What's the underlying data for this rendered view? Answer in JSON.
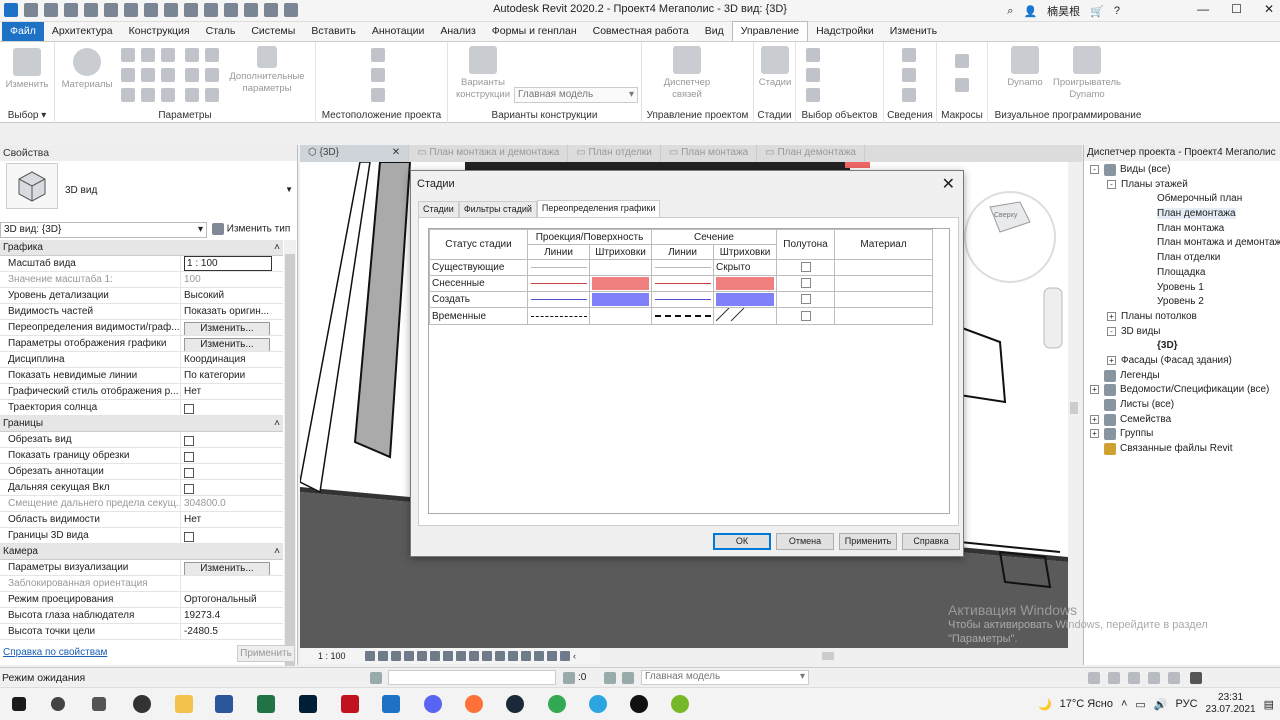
{
  "app": {
    "title": "Autodesk Revit 2020.2 - Проект4 Мегаполис - 3D вид: {3D}",
    "user": "楠昊根"
  },
  "menu": {
    "tabs": [
      "Файл",
      "Архитектура",
      "Конструкция",
      "Сталь",
      "Системы",
      "Вставить",
      "Аннотации",
      "Анализ",
      "Формы и генплан",
      "Совместная работа",
      "Вид",
      "Управление",
      "Надстройки",
      "Изменить"
    ],
    "active": "Управление"
  },
  "ribbon": {
    "modify": "Изменить",
    "materials": "Материалы",
    "additional_params": "Дополнительные параметры",
    "design_options": "Варианты конструкции",
    "main_model": "Главная модель",
    "links_manager": "Диспетчер связей",
    "phases": "Стадии",
    "dynamo": "Dynamo",
    "dynamo_player": "Проигрыватель Dynamo",
    "groups": {
      "select": "Выбор",
      "params": "Параметры",
      "location": "Местоположение проекта",
      "design_options": "Варианты конструкции",
      "project_manage": "Управление проектом",
      "phases": "Стадии",
      "select_objects": "Выбор объектов",
      "info": "Сведения",
      "macros": "Макросы",
      "visual_prog": "Визуальное программирование"
    }
  },
  "properties": {
    "header": "Свойства",
    "type_name": "3D вид",
    "instance": "3D вид: {3D}",
    "edit_type": "Изменить тип",
    "sections": [
      {
        "title": "Графика",
        "rows": [
          {
            "k": "Масштаб вида",
            "v": "1 : 100",
            "kind": "input"
          },
          {
            "k": "Значение масштаба    1:",
            "v": "100",
            "kind": "dis"
          },
          {
            "k": "Уровень детализации",
            "v": "Высокий"
          },
          {
            "k": "Видимость частей",
            "v": "Показать оригин..."
          },
          {
            "k": "Переопределения видимости/граф...",
            "v": "Изменить...",
            "kind": "btn"
          },
          {
            "k": "Параметры отображения графики",
            "v": "Изменить...",
            "kind": "btn"
          },
          {
            "k": "Дисциплина",
            "v": "Координация"
          },
          {
            "k": "Показать невидимые линии",
            "v": "По категории"
          },
          {
            "k": "Графический стиль отображения р...",
            "v": "Нет"
          },
          {
            "k": "Траектория солнца",
            "v": "",
            "kind": "cb"
          }
        ]
      },
      {
        "title": "Границы",
        "rows": [
          {
            "k": "Обрезать вид",
            "v": "",
            "kind": "cb"
          },
          {
            "k": "Показать границу обрезки",
            "v": "",
            "kind": "cb"
          },
          {
            "k": "Обрезать аннотации",
            "v": "",
            "kind": "cb"
          },
          {
            "k": "Дальняя секущая Вкл",
            "v": "",
            "kind": "cb"
          },
          {
            "k": "Смещение дальнего предела секущ...",
            "v": "304800.0",
            "kind": "dis"
          },
          {
            "k": "Область видимости",
            "v": "Нет"
          },
          {
            "k": "Границы 3D вида",
            "v": "",
            "kind": "cb"
          }
        ]
      },
      {
        "title": "Камера",
        "rows": [
          {
            "k": "Параметры визуализации",
            "v": "Изменить...",
            "kind": "btn"
          },
          {
            "k": "Заблокированная ориентация",
            "v": "",
            "kind": "dis"
          },
          {
            "k": "Режим проецирования",
            "v": "Ортогональный"
          },
          {
            "k": "Высота глаза наблюдателя",
            "v": "19273.4"
          },
          {
            "k": "Высота точки цели",
            "v": "-2480.5"
          }
        ]
      }
    ],
    "help_link": "Справка по свойствам",
    "apply": "Применить"
  },
  "view_tabs": [
    "{3D}",
    "План монтажа и демонтажа",
    "План отделки",
    "План монтажа",
    "План демонтажа"
  ],
  "view_scale": "1 : 100",
  "browser": {
    "header": "Диспетчер проекта - Проект4 Мегаполис",
    "items": [
      {
        "label": "Виды (все)",
        "level": 0,
        "exp": "-",
        "icon": true
      },
      {
        "label": "Планы этажей",
        "level": 1,
        "exp": "-"
      },
      {
        "label": "Обмерочный план",
        "level": 2
      },
      {
        "label": "План демонтажа",
        "level": 2,
        "sel": true
      },
      {
        "label": "План монтажа",
        "level": 2
      },
      {
        "label": "План монтажа и демонтажа",
        "level": 2
      },
      {
        "label": "План отделки",
        "level": 2
      },
      {
        "label": "Площадка",
        "level": 2
      },
      {
        "label": "Уровень 1",
        "level": 2
      },
      {
        "label": "Уровень 2",
        "level": 2
      },
      {
        "label": "Планы потолков",
        "level": 1,
        "exp": "+"
      },
      {
        "label": "3D виды",
        "level": 1,
        "exp": "-"
      },
      {
        "label": "{3D}",
        "level": 2,
        "bold": true
      },
      {
        "label": "Фасады (Фасад здания)",
        "level": 1,
        "exp": "+"
      },
      {
        "label": "Легенды",
        "level": 0,
        "icon": true
      },
      {
        "label": "Ведомости/Спецификации (все)",
        "level": 0,
        "exp": "+",
        "icon": true
      },
      {
        "label": "Листы (все)",
        "level": 0,
        "icon": true
      },
      {
        "label": "Семейства",
        "level": 0,
        "exp": "+",
        "icon": true
      },
      {
        "label": "Группы",
        "level": 0,
        "exp": "+",
        "icon": true
      },
      {
        "label": "Связанные файлы Revit",
        "level": 0,
        "icon": true
      }
    ]
  },
  "dialog": {
    "title": "Стадии",
    "tabs": [
      "Стадии",
      "Фильтры стадий",
      "Переопределения графики"
    ],
    "active_tab": 2,
    "headers": {
      "status": "Статус стадии",
      "projection": "Проекция/Поверхность",
      "section": "Сечение",
      "lines": "Линии",
      "hatch": "Штриховки",
      "halftone": "Полутона",
      "material": "Материал"
    },
    "rows": [
      {
        "name": "Существующие",
        "section_hatch": "Скрыто",
        "color": ""
      },
      {
        "name": "Снесенные",
        "color": "#f08080",
        "line_color": "#c94040"
      },
      {
        "name": "Создать",
        "color": "#8080f8",
        "line_color": "#5050d0"
      },
      {
        "name": "Временные",
        "dashed": true
      }
    ],
    "buttons": {
      "ok": "ОК",
      "cancel": "Отмена",
      "apply": "Применить",
      "help": "Справка"
    }
  },
  "status": {
    "text": "Режим ожидания",
    "zero": ":0",
    "model": "Главная модель"
  },
  "watermark": {
    "title": "Активация Windows",
    "sub1": "Чтобы активировать Windows, перейдите в раздел",
    "sub2": "\"Параметры\"."
  },
  "taskbar": {
    "weather": "17°C Ясно",
    "lang": "РУС",
    "time": "23:31",
    "date": "23.07.2021"
  }
}
